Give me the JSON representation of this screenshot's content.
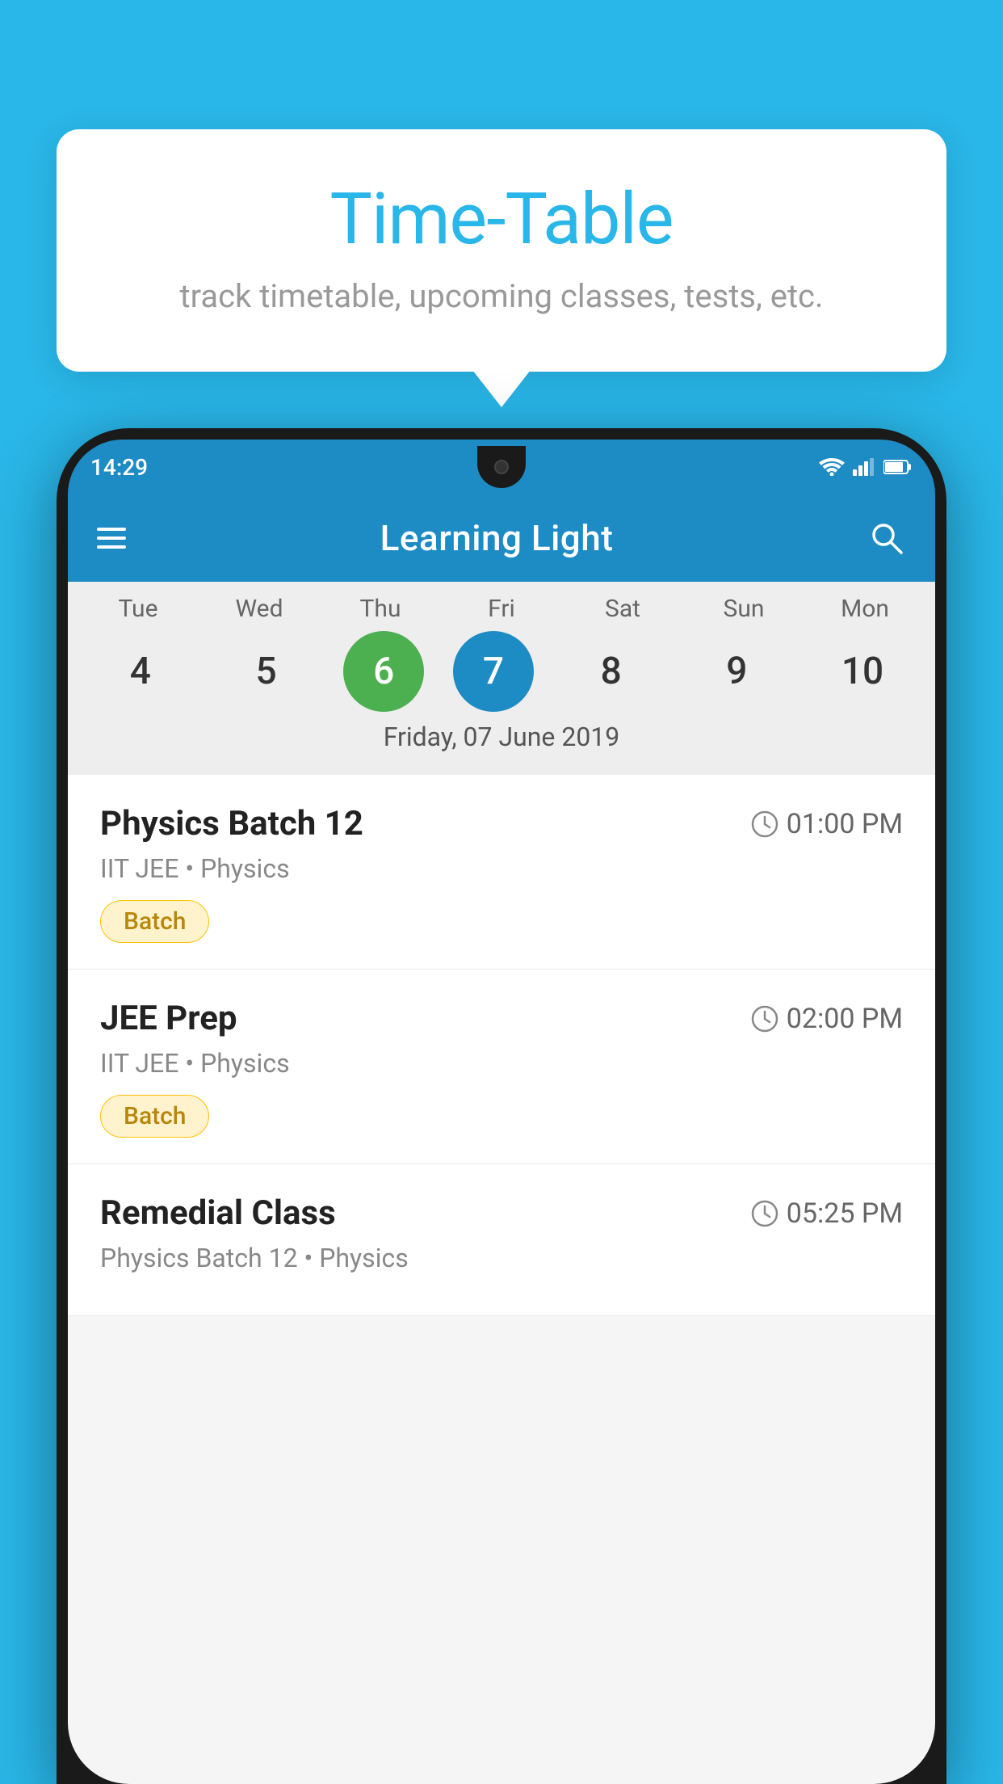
{
  "background_color": "#29b6e8",
  "tooltip": {
    "title": "Time-Table",
    "subtitle": "track timetable, upcoming classes, tests, etc."
  },
  "phone": {
    "status_bar": {
      "time": "14:29"
    },
    "app_bar": {
      "title": "Learning Light",
      "menu_icon": "hamburger-icon",
      "search_icon": "search-icon"
    },
    "calendar": {
      "days": [
        {
          "label": "Tue",
          "number": "4"
        },
        {
          "label": "Wed",
          "number": "5"
        },
        {
          "label": "Thu",
          "number": "6",
          "state": "today"
        },
        {
          "label": "Fri",
          "number": "7",
          "state": "selected"
        },
        {
          "label": "Sat",
          "number": "8"
        },
        {
          "label": "Sun",
          "number": "9"
        },
        {
          "label": "Mon",
          "number": "10"
        }
      ],
      "selected_date_label": "Friday, 07 June 2019"
    },
    "schedule": [
      {
        "title": "Physics Batch 12",
        "time": "01:00 PM",
        "subtitle": "IIT JEE • Physics",
        "badge": "Batch"
      },
      {
        "title": "JEE Prep",
        "time": "02:00 PM",
        "subtitle": "IIT JEE • Physics",
        "badge": "Batch"
      },
      {
        "title": "Remedial Class",
        "time": "05:25 PM",
        "subtitle": "Physics Batch 12 • Physics",
        "badge": null
      }
    ]
  }
}
